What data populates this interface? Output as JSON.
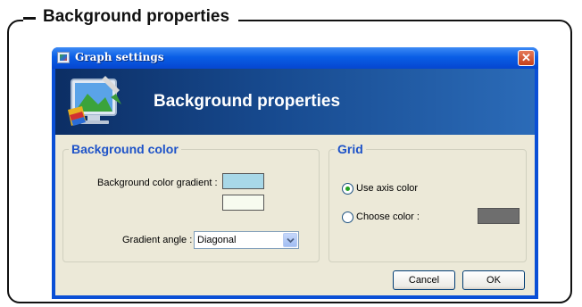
{
  "figure": {
    "caption": "Background properties"
  },
  "window": {
    "title": "Graph settings",
    "close_symbol": "✕"
  },
  "banner": {
    "title": "Background properties"
  },
  "background_group": {
    "title": "Background color",
    "gradient_label": "Background color gradient :",
    "gradient_color_1": "#a8d8e8",
    "gradient_color_2": "#f7fbef",
    "angle_label": "Gradient angle :",
    "angle_value": "Diagonal"
  },
  "grid_group": {
    "title": "Grid",
    "use_axis_label": "Use axis color",
    "use_axis_selected": true,
    "choose_color_label": "Choose color :",
    "choose_color_selected": false,
    "chosen_color": "#6e6e6e"
  },
  "buttons": {
    "cancel": "Cancel",
    "ok": "OK"
  },
  "colors": {
    "title_accent": "#1d52c8",
    "window_frame": "#0a4fd6",
    "dialog_face": "#ece9d8"
  }
}
